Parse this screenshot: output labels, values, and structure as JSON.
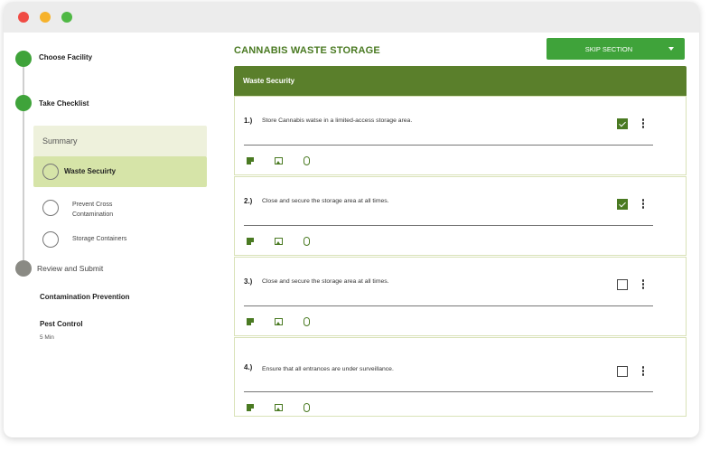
{
  "window": {
    "controls": [
      "close",
      "minimize",
      "maximize"
    ]
  },
  "sidebar": {
    "steps": [
      {
        "label": "Choose Facility",
        "status": "done"
      },
      {
        "label": "Take Checklist",
        "status": "done"
      },
      {
        "label": "Review and Submit",
        "status": "pending"
      }
    ],
    "summary_label": "Summary",
    "active_item": "Waste Secuirty",
    "sub_items": [
      "Prevent Cross Contamination",
      "Storage Containers"
    ],
    "other_sections": [
      {
        "title": "Contamination Prevention",
        "meta": ""
      },
      {
        "title": "Pest Control",
        "meta": "5 Min"
      }
    ]
  },
  "main": {
    "title": "CANNABIS WASTE STORAGE",
    "skip_label": "SKIP SECTION",
    "section_title": "Waste Security",
    "questions": [
      {
        "num": "1.)",
        "text": "Store Cannabis watse in a limited-access storage area.",
        "checked": true
      },
      {
        "num": "2.)",
        "text": "Close and secure the storage area at all times.",
        "checked": true
      },
      {
        "num": "3.)",
        "text": "Close and secure the storage area at all times.",
        "checked": false
      },
      {
        "num": "4.)",
        "text": "Ensure that all entrances are under surveillance.",
        "checked": false
      }
    ],
    "action_icons": [
      "note-icon",
      "image-icon",
      "attachment-icon"
    ]
  },
  "colors": {
    "accent_green": "#3fa33a",
    "section_header": "#5a7f2b",
    "title_green": "#4a7a22",
    "active_bg": "#d6e4a8",
    "summary_bg": "#eef1dc"
  }
}
